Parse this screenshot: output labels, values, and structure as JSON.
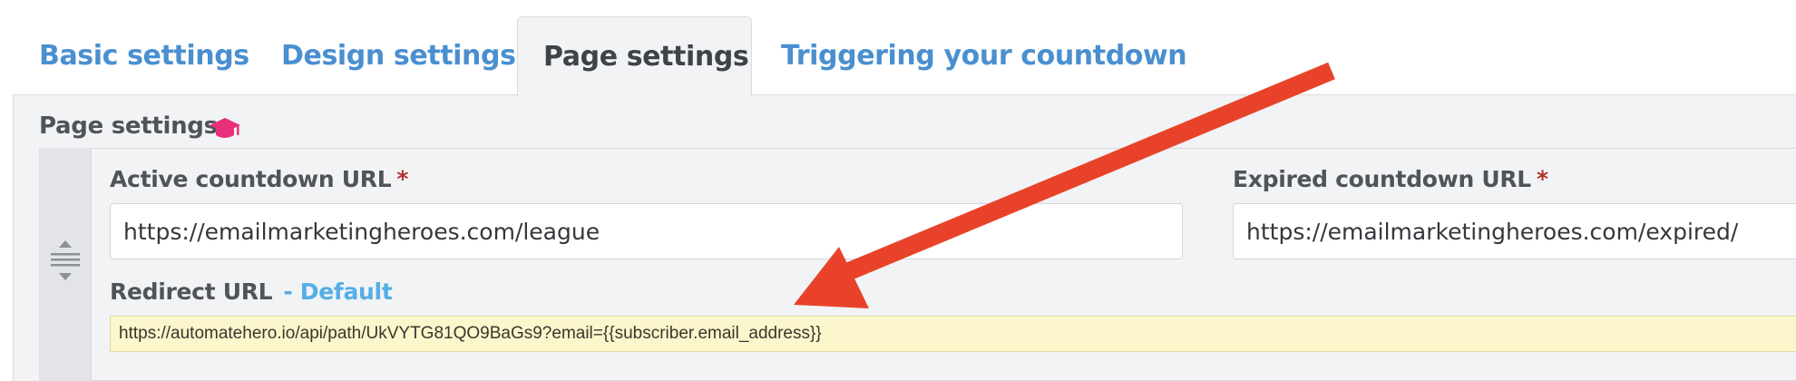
{
  "tabs": [
    {
      "label": "Basic settings"
    },
    {
      "label": "Design settings"
    },
    {
      "label": "Page settings"
    },
    {
      "label": "Triggering your countdown"
    }
  ],
  "section": {
    "title": "Page settings"
  },
  "fields": {
    "active": {
      "label": "Active countdown URL",
      "required_mark": "*",
      "value": "https://emailmarketingheroes.com/league"
    },
    "expired": {
      "label": "Expired countdown URL",
      "required_mark": "*",
      "value": "https://emailmarketingheroes.com/expired/"
    },
    "redirect": {
      "label": "Redirect URL",
      "default_tag": "- Default",
      "value": "https://automatehero.io/api/path/UkVYTG81QO9BaGs9?email={{subscriber.email_address}}"
    }
  },
  "colors": {
    "tab_link": "#4a8fd0",
    "required": "#b0322a",
    "default_tag": "#55aee6",
    "annotation_arrow": "#e8432a",
    "cap_icon": "#e8307a"
  },
  "icons": [
    "graduation-cap-icon",
    "drag-handle-icon",
    "annotation-arrow"
  ]
}
